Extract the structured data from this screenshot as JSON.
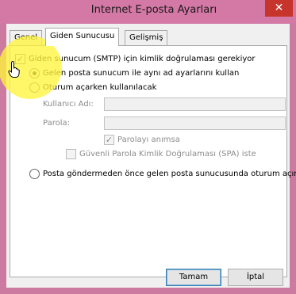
{
  "window": {
    "title": "Internet E-posta Ayarları",
    "close_glyph": "✕"
  },
  "tabs": [
    {
      "label": "Genel",
      "active": false
    },
    {
      "label": "Giden Sunucusu",
      "active": true
    },
    {
      "label": "Gelişmiş",
      "active": false
    }
  ],
  "outgoing": {
    "auth_required": {
      "label": "Giden sunucum (SMTP) için kimlik doğrulaması gerekiyor",
      "checked": true
    },
    "same_settings": {
      "label": "Gelen posta sunucum ile aynı ad ayarlarını kullan",
      "selected": true
    },
    "logon_using": {
      "label": "Oturum açarken kullanılacak",
      "selected": false
    },
    "username": {
      "label": "Kullanıcı Adı:",
      "value": ""
    },
    "password": {
      "label": "Parola:",
      "value": ""
    },
    "remember_password": {
      "label": "Parolayı anımsa",
      "checked": true
    },
    "spa": {
      "label": "Güvenli Parola Kimlik Doğrulaması (SPA) iste",
      "checked": false
    },
    "logon_incoming_first": {
      "label": "Posta göndermeden önce gelen posta sunucusunda oturum açın",
      "selected": false
    }
  },
  "buttons": {
    "ok": "Tamam",
    "cancel": "İptal"
  },
  "colors": {
    "titlebar": "#d478a5",
    "close": "#c7342c",
    "highlight": "#fff53c"
  },
  "icons": {
    "cursor": "hand-pointer-icon",
    "check": "checkmark-icon"
  }
}
